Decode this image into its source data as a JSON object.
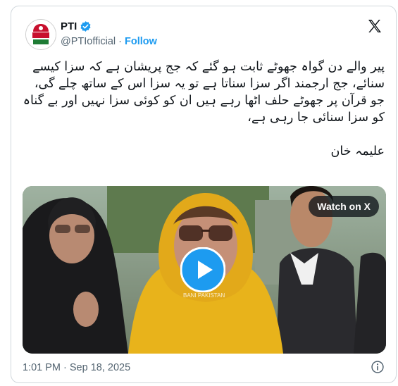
{
  "post": {
    "author_name": "PTI",
    "handle": "@PTIofficial",
    "separator": "·",
    "follow_label": "Follow",
    "text_line1": "پیر والے دن گواہ جھوٹے ثابت ہو گئے کہ جج پریشان ہے کہ سزا کیسے سنائے، جج ارجمند اگر سزا سناتا ہے تو یہ سزا اس کے ساتھ چلے گی،",
    "text_line2": "جو قرآن پر جھوٹے حلف اٹھا رہے ہیں ان کو کوئی سزا نہیں اور بے گناہ کو سزا سنائی جا رہی ہے،",
    "signature": "علیمہ خان",
    "watch_label": "Watch on X",
    "video_watermark": "BANI PAKISTAN",
    "timestamp": "1:01 PM · Sep 18, 2025"
  },
  "icons": {
    "verified": "verified-badge-icon",
    "x_logo": "x-logo-icon",
    "play": "play-icon",
    "info": "info-icon"
  },
  "colors": {
    "accent": "#1d9bf0",
    "text": "#0f1419",
    "muted": "#536471"
  }
}
